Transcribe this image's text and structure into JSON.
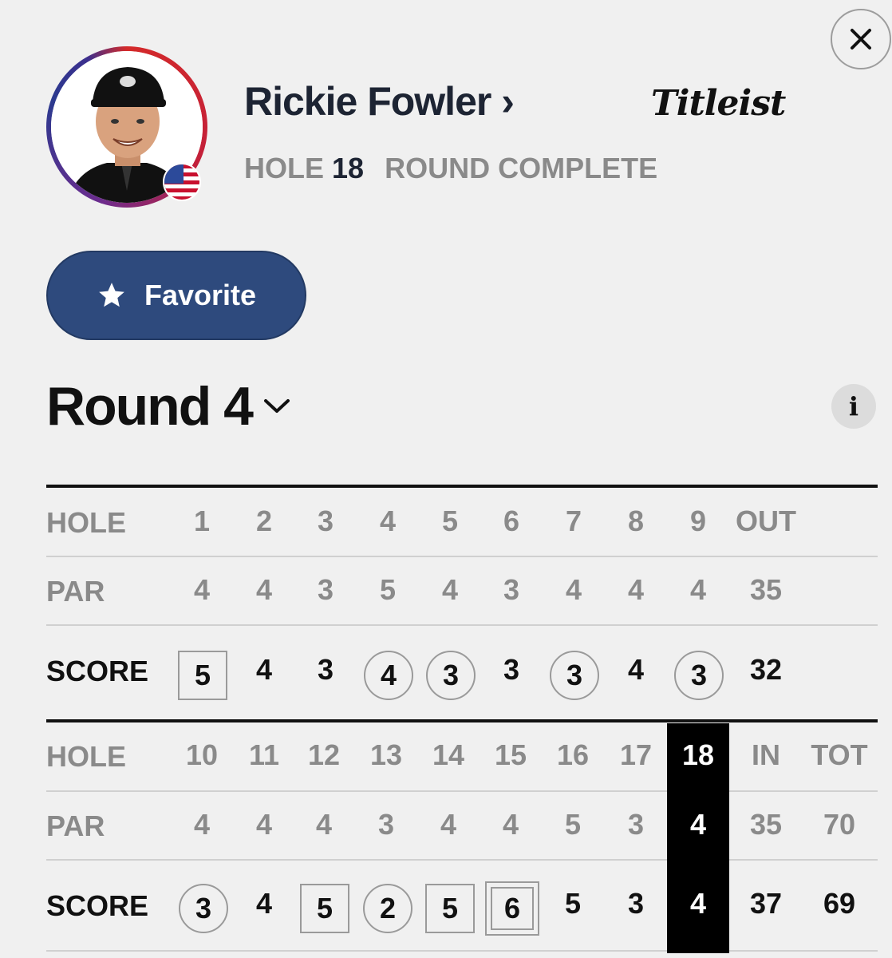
{
  "header": {
    "close_icon": "close-icon",
    "player_name": "Rickie Fowler",
    "player_chevron": "›",
    "sponsor": "Titleist",
    "hole_label": "HOLE",
    "hole_number": "18",
    "round_status": "ROUND COMPLETE",
    "country_flag": "us-flag-icon"
  },
  "favorite": {
    "label": "Favorite",
    "icon": "star-icon"
  },
  "round": {
    "title": "Round 4",
    "icon": "chevron-down-icon",
    "info_icon": "info-icon",
    "info_glyph": "i"
  },
  "colors": {
    "accent": "#2e4a7d",
    "current_hole_bg": "#000000",
    "ring_red": "#d42a2a",
    "ring_blue": "#2b3a8f"
  },
  "front_nine": {
    "hole_label": "HOLE",
    "par_label": "PAR",
    "score_label": "SCORE",
    "holes": [
      "1",
      "2",
      "3",
      "4",
      "5",
      "6",
      "7",
      "8",
      "9"
    ],
    "out_label": "OUT",
    "pars": [
      "4",
      "4",
      "3",
      "5",
      "4",
      "3",
      "4",
      "4",
      "4"
    ],
    "out_par": "35",
    "scores": [
      {
        "value": "5",
        "mark": "bogey-square"
      },
      {
        "value": "4",
        "mark": "none"
      },
      {
        "value": "3",
        "mark": "none"
      },
      {
        "value": "4",
        "mark": "birdie-circle"
      },
      {
        "value": "3",
        "mark": "birdie-circle"
      },
      {
        "value": "3",
        "mark": "none"
      },
      {
        "value": "3",
        "mark": "birdie-circle"
      },
      {
        "value": "4",
        "mark": "none"
      },
      {
        "value": "3",
        "mark": "birdie-circle"
      }
    ],
    "out_score": "32"
  },
  "back_nine": {
    "hole_label": "HOLE",
    "par_label": "PAR",
    "score_label": "SCORE",
    "holes": [
      "10",
      "11",
      "12",
      "13",
      "14",
      "15",
      "16",
      "17",
      "18"
    ],
    "in_label": "IN",
    "tot_label": "TOT",
    "pars": [
      "4",
      "4",
      "4",
      "3",
      "4",
      "4",
      "5",
      "3",
      "4"
    ],
    "in_par": "35",
    "tot_par": "70",
    "scores": [
      {
        "value": "3",
        "mark": "birdie-circle"
      },
      {
        "value": "4",
        "mark": "none"
      },
      {
        "value": "5",
        "mark": "bogey-square"
      },
      {
        "value": "2",
        "mark": "birdie-circle"
      },
      {
        "value": "5",
        "mark": "bogey-square"
      },
      {
        "value": "6",
        "mark": "double-bogey-square"
      },
      {
        "value": "5",
        "mark": "none"
      },
      {
        "value": "3",
        "mark": "none"
      },
      {
        "value": "4",
        "mark": "none"
      }
    ],
    "in_score": "37",
    "tot_score": "69",
    "current_hole": "18"
  }
}
